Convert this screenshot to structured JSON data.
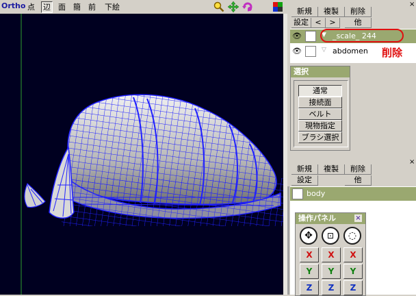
{
  "toolbar": {
    "title": "Ortho",
    "buttons": [
      "点",
      "辺",
      "面",
      "簡",
      "前",
      "下絵"
    ],
    "active": [
      "辺"
    ],
    "icons": [
      "zoom-icon",
      "move-icon",
      "rotate-icon",
      "color-palette-icon"
    ]
  },
  "object_panel": {
    "row1": [
      "新規",
      "複製",
      "削除"
    ],
    "row2": [
      "設定",
      "<",
      ">",
      "他"
    ],
    "objects": [
      {
        "name": "_scale_ 244",
        "selected": true,
        "expanded": true
      },
      {
        "name": "abdomen",
        "selected": false,
        "expanded": false
      }
    ],
    "annotation": "削除",
    "annotation_color": "#e01010",
    "highlight_color": "#9aa870"
  },
  "select_panel": {
    "title": "選択",
    "buttons": [
      "通常",
      "接続面",
      "ベルト",
      "現物指定",
      "ブラシ選択"
    ]
  },
  "material_panel": {
    "row1": [
      "新規",
      "複製",
      "削除"
    ],
    "row2": [
      "設定",
      "他"
    ],
    "materials": [
      {
        "name": "body",
        "selected": true
      }
    ],
    "highlight_color": "#9aa870"
  },
  "op_panel": {
    "title": "操作パネル",
    "title_color": "#9aa870",
    "tool_icons": [
      "move-arrows-icon",
      "scale-box-icon",
      "rotate-circle-icon"
    ],
    "axes": [
      {
        "label": "X",
        "color": "#d01010"
      },
      {
        "label": "Y",
        "color": "#108010"
      },
      {
        "label": "Z",
        "color": "#1030c0"
      }
    ]
  },
  "colors": {
    "viewport_bg": "#000020",
    "wire": "#2020ff",
    "mesh_fill": "#c8c8c8"
  }
}
